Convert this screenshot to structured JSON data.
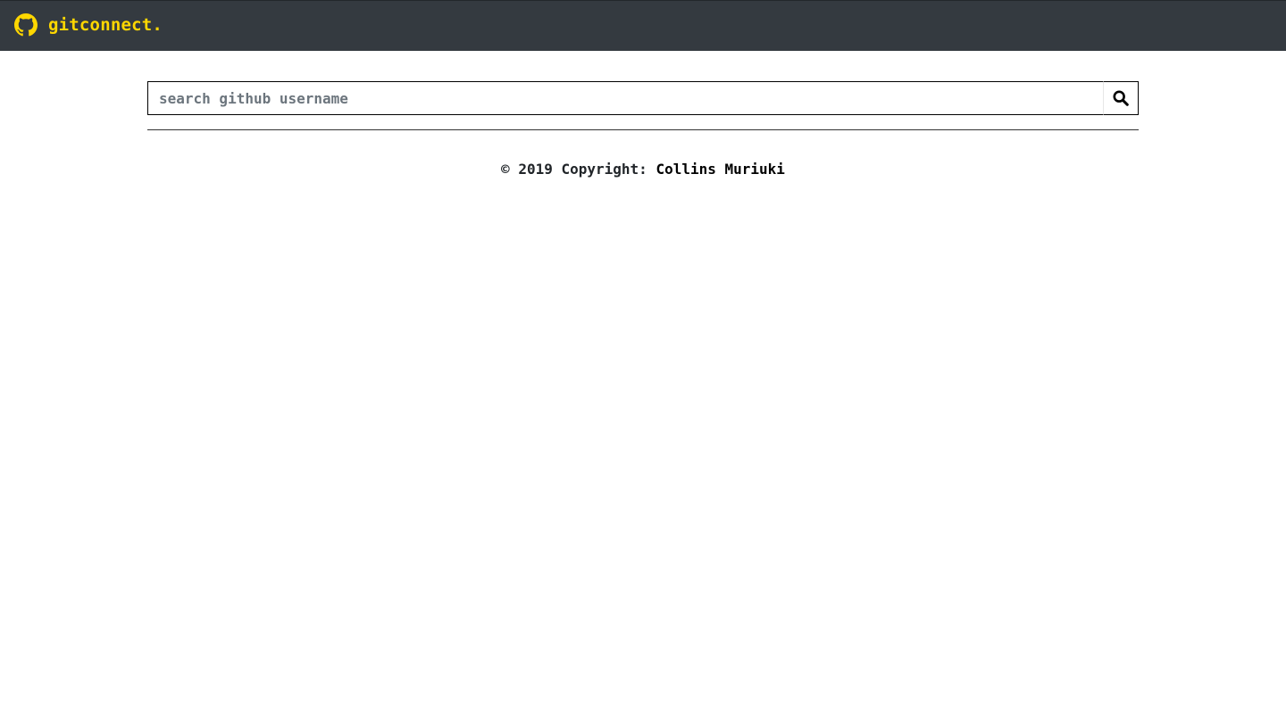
{
  "header": {
    "brand_label": "gitconnect.",
    "brand_icon": "github-icon",
    "brand_color": "#ffd700",
    "background_color": "#343a40"
  },
  "search": {
    "placeholder": "search github username",
    "value": "",
    "button_icon": "search-icon"
  },
  "footer": {
    "copyright_text": "© 2019 Copyright: ",
    "author_link": "Collins Muriuki"
  }
}
